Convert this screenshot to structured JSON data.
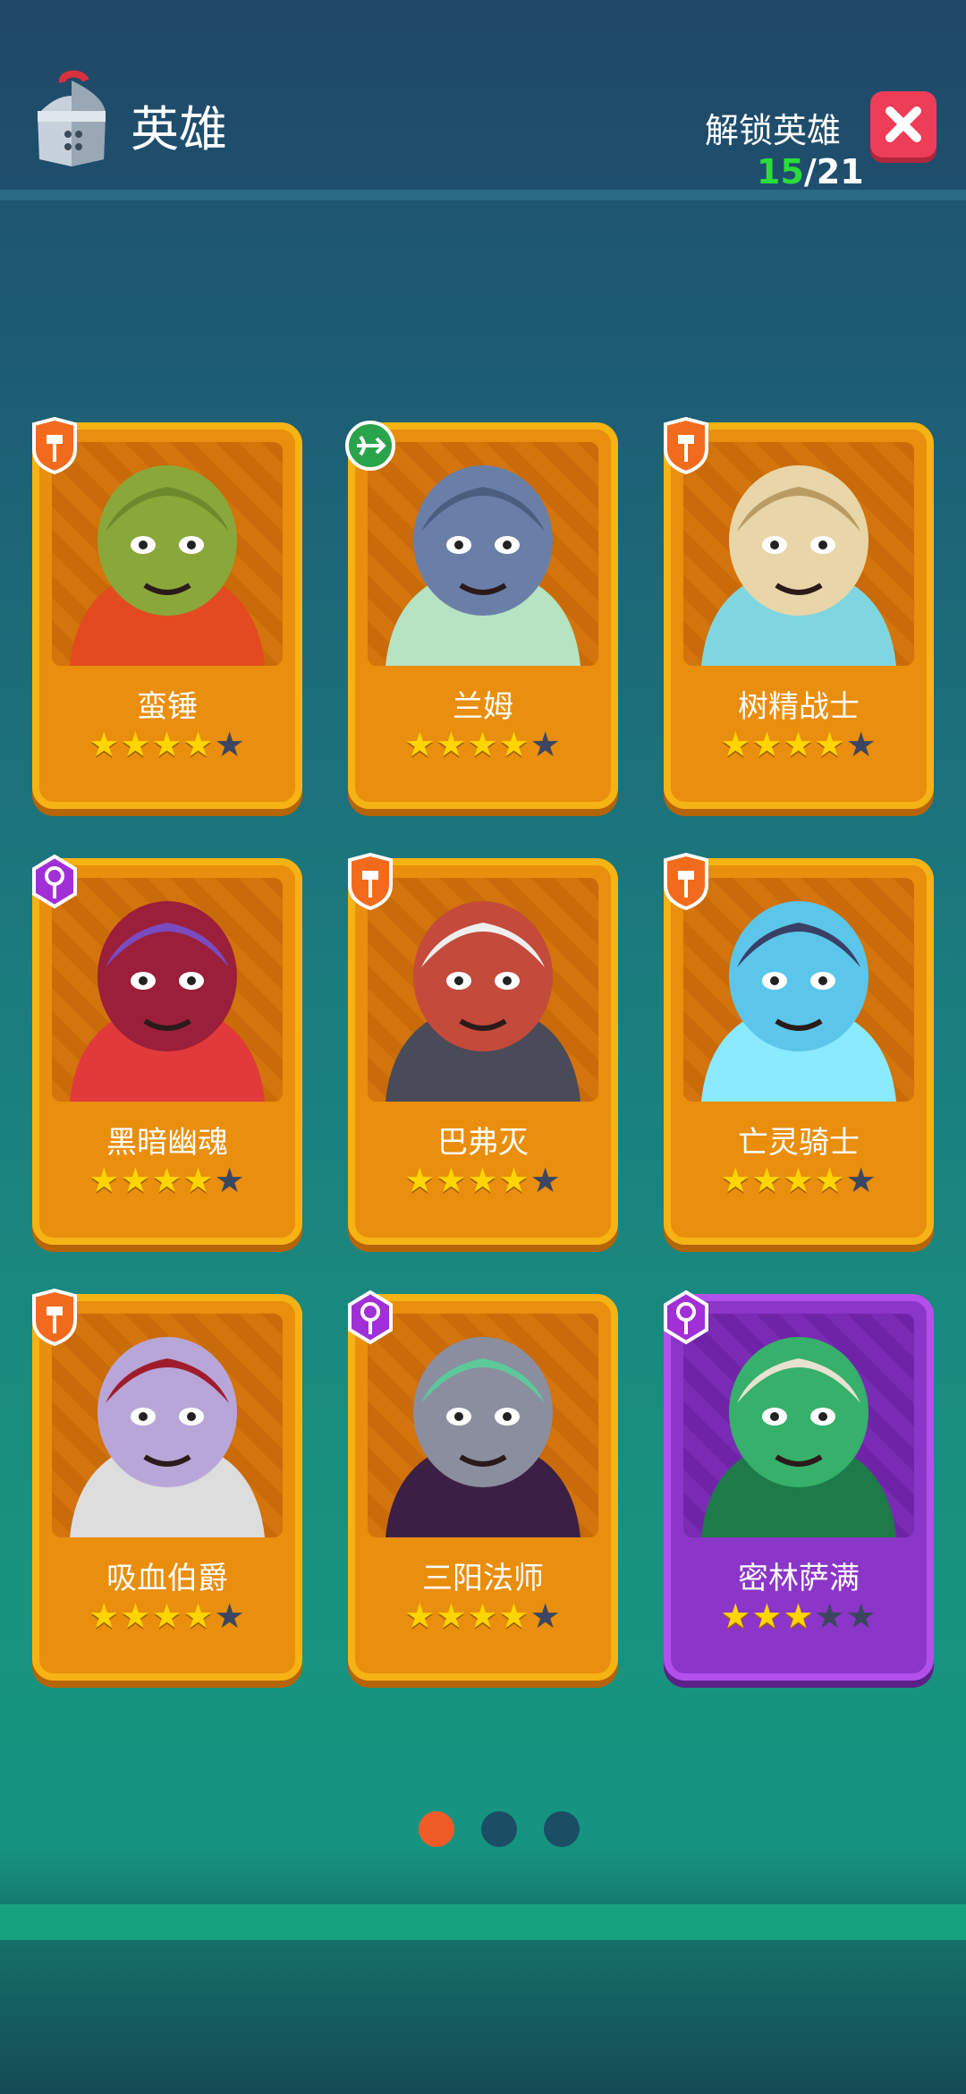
{
  "header": {
    "title": "英雄",
    "unlock_label": "解锁英雄",
    "unlocked": "15",
    "total": "/21"
  },
  "heroes": [
    {
      "name": "蛮锤",
      "stars": 4,
      "badge": "warrior-badge-icon",
      "rarity": "orange",
      "portrait_colors": [
        "#8aa83a",
        "#6c8a2b",
        "#e44a1f"
      ]
    },
    {
      "name": "兰姆",
      "stars": 4,
      "badge": "archer-badge-icon",
      "rarity": "orange",
      "portrait_colors": [
        "#6a7fa8",
        "#4c5e80",
        "#b6e3c2"
      ]
    },
    {
      "name": "树精战士",
      "stars": 4,
      "badge": "warrior-badge-icon",
      "rarity": "orange",
      "portrait_colors": [
        "#e8d6a8",
        "#b99c64",
        "#7fd6e0"
      ]
    },
    {
      "name": "黑暗幽魂",
      "stars": 4,
      "badge": "mage-badge-icon",
      "rarity": "orange",
      "portrait_colors": [
        "#9b1f3a",
        "#7a4bc0",
        "#e23a3a"
      ]
    },
    {
      "name": "巴弗灭",
      "stars": 4,
      "badge": "warrior-badge-icon",
      "rarity": "orange",
      "portrait_colors": [
        "#c44a3c",
        "#eeeeee",
        "#4a4a58"
      ]
    },
    {
      "name": "亡灵骑士",
      "stars": 4,
      "badge": "warrior-badge-icon",
      "rarity": "orange",
      "portrait_colors": [
        "#5bc6ea",
        "#3a3f66",
        "#8aeaff"
      ]
    },
    {
      "name": "吸血伯爵",
      "stars": 4,
      "badge": "warrior-badge-icon",
      "rarity": "orange",
      "portrait_colors": [
        "#b9a6d8",
        "#a01c2c",
        "#dddddd"
      ]
    },
    {
      "name": "三阳法师",
      "stars": 4,
      "badge": "mage-badge-icon",
      "rarity": "orange",
      "portrait_colors": [
        "#8b8e9e",
        "#5dc99a",
        "#3b2044"
      ]
    },
    {
      "name": "密林萨满",
      "stars": 3,
      "badge": "mage-badge-icon",
      "rarity": "purple",
      "portrait_colors": [
        "#36b06a",
        "#e8e2d0",
        "#1e7a48"
      ]
    }
  ],
  "pager": {
    "pages": 3,
    "current": 0
  }
}
